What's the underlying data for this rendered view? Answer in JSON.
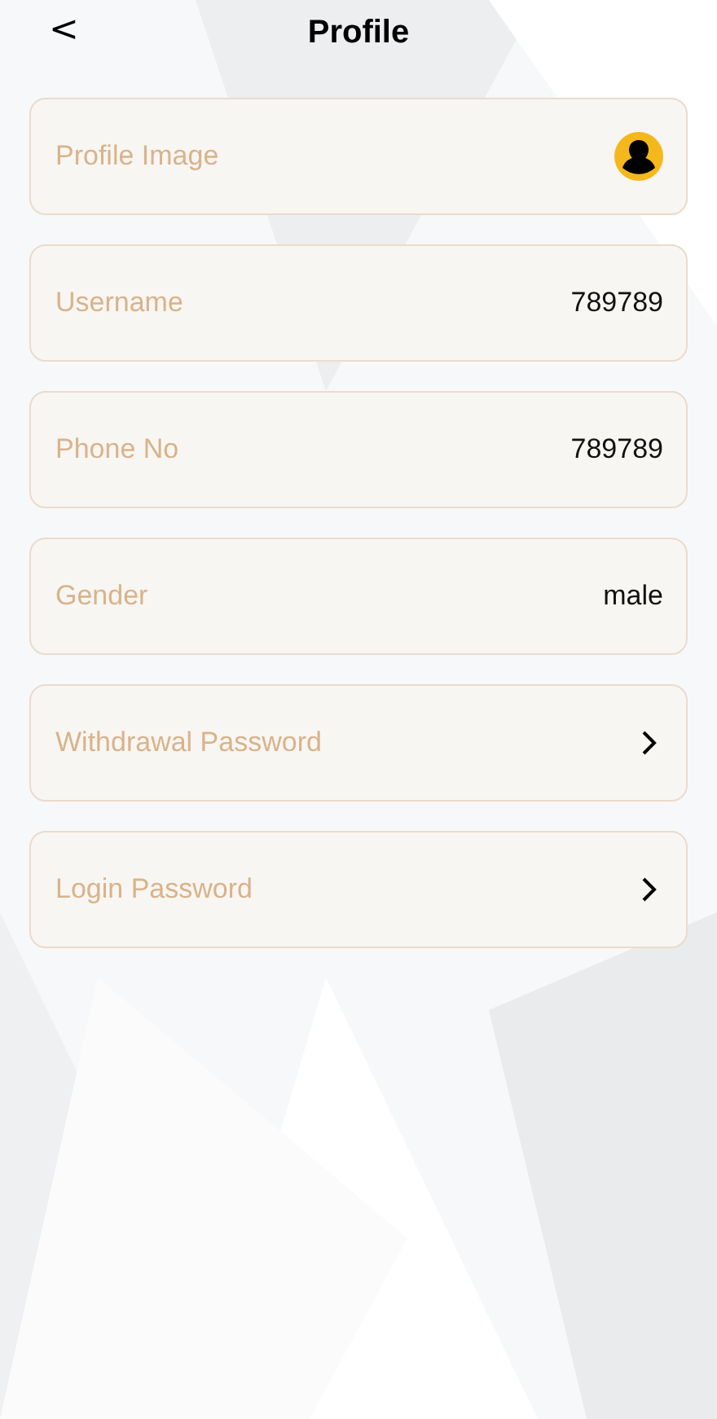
{
  "header": {
    "back": "<",
    "title": "Profile"
  },
  "rows": [
    {
      "kind": "avatar",
      "label": "Profile Image"
    },
    {
      "kind": "value",
      "label": "Username",
      "value": "789789"
    },
    {
      "kind": "value",
      "label": "Phone No",
      "value": "789789"
    },
    {
      "kind": "value",
      "label": "Gender",
      "value": "male"
    },
    {
      "kind": "link",
      "label": "Withdrawal Password"
    },
    {
      "kind": "link",
      "label": "Login Password"
    }
  ]
}
